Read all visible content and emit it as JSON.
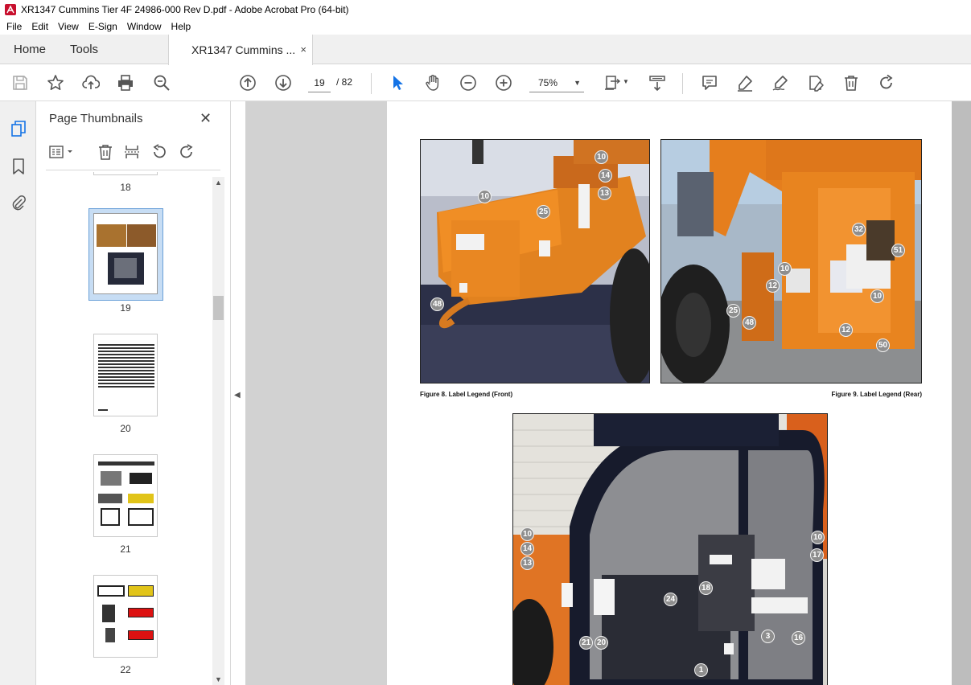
{
  "window": {
    "title": "XR1347 Cummins Tier 4F 24986-000 Rev D.pdf - Adobe Acrobat Pro (64-bit)"
  },
  "menu": [
    "File",
    "Edit",
    "View",
    "E-Sign",
    "Window",
    "Help"
  ],
  "tabs": {
    "home": "Home",
    "tools": "Tools",
    "document": "XR1347 Cummins ...",
    "close": "×"
  },
  "toolbar": {
    "page_current": "19",
    "page_total": "/  82",
    "zoom": "75%"
  },
  "thumbnails": {
    "title": "Page Thumbnails",
    "close": "✕",
    "selected_page": "19",
    "pages": [
      "18",
      "19",
      "20",
      "21",
      "22"
    ]
  },
  "document": {
    "figure_front_caption": "Figure 8. Label Legend (Front)",
    "figure_rear_caption": "Figure 9. Label Legend (Rear)",
    "front_callouts": [
      "10",
      "14",
      "13",
      "10",
      "25",
      "48"
    ],
    "rear_callouts": [
      "32",
      "51",
      "10",
      "12",
      "10",
      "25",
      "48",
      "12",
      "50"
    ],
    "cab_callouts": [
      "10",
      "14",
      "13",
      "10",
      "17",
      "18",
      "24",
      "21",
      "20",
      "3",
      "16",
      "1"
    ]
  },
  "colors": {
    "accent": "#1473e6",
    "machine_orange": "#e07a22"
  }
}
